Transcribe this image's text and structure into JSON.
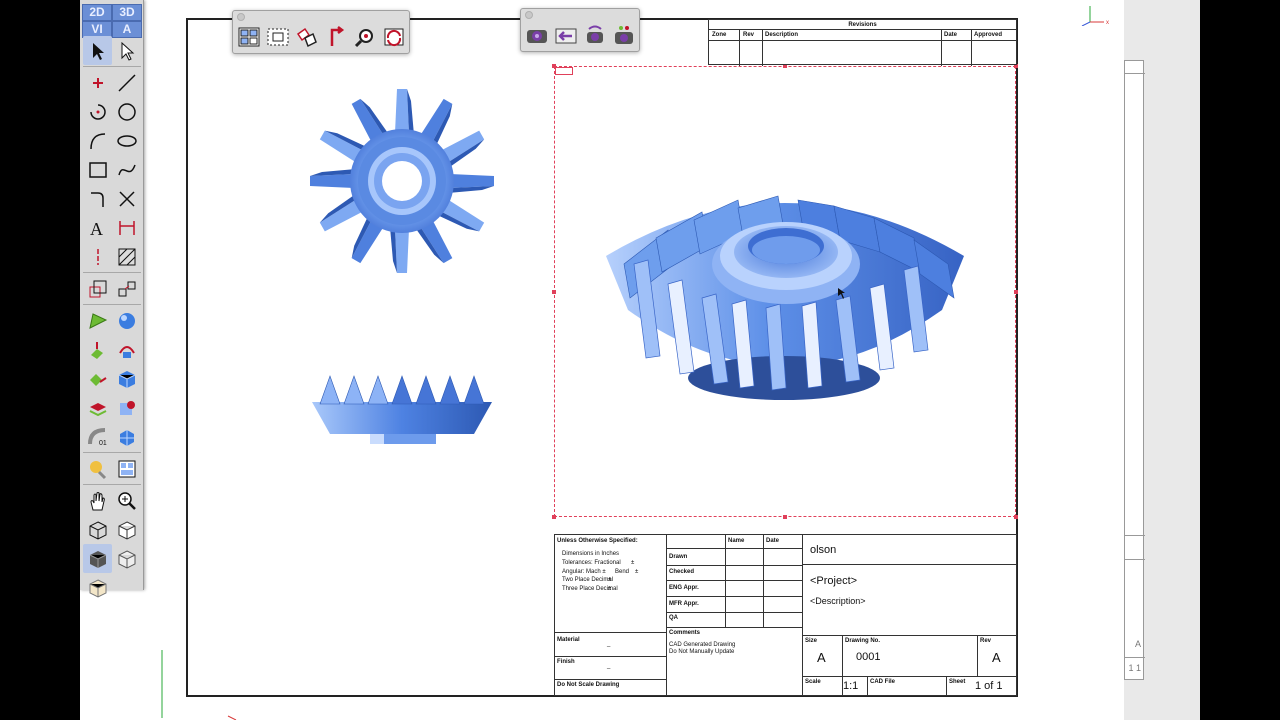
{
  "palette": {
    "mode_labels": [
      "2D",
      "3D",
      "VI",
      "A"
    ],
    "tools": [
      {
        "name": "select-arrow-icon",
        "selected": true
      },
      {
        "name": "select-outline-arrow-icon"
      },
      {
        "name": "point-icon"
      },
      {
        "name": "line-icon"
      },
      {
        "name": "arc-icon"
      },
      {
        "name": "circle-icon"
      },
      {
        "name": "curve-arc-icon"
      },
      {
        "name": "ellipse-icon"
      },
      {
        "name": "rectangle-icon"
      },
      {
        "name": "spline-icon"
      },
      {
        "name": "fillet-icon"
      },
      {
        "name": "trim-icon"
      },
      {
        "name": "text-icon"
      },
      {
        "name": "dimension-icon"
      },
      {
        "name": "centerline-icon"
      },
      {
        "name": "hatch-icon"
      },
      {
        "name": "scale-icon"
      },
      {
        "name": "transform-icon"
      },
      {
        "name": "solid-cone-icon"
      },
      {
        "name": "solid-sphere-icon"
      },
      {
        "name": "extrude-icon"
      },
      {
        "name": "revolve-icon"
      },
      {
        "name": "loft-icon"
      },
      {
        "name": "solid-cube-icon"
      },
      {
        "name": "shell-icon"
      },
      {
        "name": "boolean-icon"
      },
      {
        "name": "blend-icon"
      },
      {
        "name": "mesh-icon"
      },
      {
        "name": "render-light-icon"
      },
      {
        "name": "view-layout-icon"
      },
      {
        "name": "pan-hand-icon"
      },
      {
        "name": "zoom-icon"
      },
      {
        "name": "view-cube-wire-icon"
      },
      {
        "name": "view-cube-outline-icon"
      },
      {
        "name": "view-cube-shaded-icon",
        "selected": true
      },
      {
        "name": "view-cube-hidden-icon"
      },
      {
        "name": "view-cube-alt-icon"
      }
    ]
  },
  "layout_toolbar": {
    "buttons": [
      "layout-grid-icon",
      "marquee-select-icon",
      "align-icon",
      "flip-icon",
      "view-magnify-icon",
      "rotate-view-icon"
    ]
  },
  "camera_toolbar": {
    "buttons": [
      "camera-icon",
      "camera-back-icon",
      "camera-rotate-icon",
      "camera-link-icon"
    ]
  },
  "revisions": {
    "title": "Revisions",
    "headers": [
      "Zone",
      "Rev",
      "Description",
      "Date",
      "Approved"
    ]
  },
  "title_block": {
    "unless_specified": "Unless Otherwise Specified:",
    "dimensions": "Dimensions in Inches",
    "tolerances": "Tolerances: Fractional",
    "tol_fractional_val": "±",
    "angular": "Angular: Mach ±",
    "bend": "Bend",
    "bend_val": "±",
    "two_place": "Two Place Decimal",
    "two_place_val": "±",
    "three_place": "Three Place Decimal",
    "three_place_val": "±",
    "material_label": "Material",
    "material_value": "_",
    "finish_label": "Finish",
    "finish_value": "_",
    "do_not_scale": "Do Not Scale Drawing",
    "col_name": "Name",
    "col_date": "Date",
    "row_drawn": "Drawn",
    "row_checked": "Checked",
    "row_eng": "ENG Appr.",
    "row_mfr": "MFR Appr.",
    "row_qa": "QA",
    "comments_label": "Comments",
    "comment_1": "CAD Generated Drawing",
    "comment_2": "Do Not Manually Update",
    "company": "olson",
    "project": "<Project>",
    "description": "<Description>",
    "size_label": "Size",
    "size_value": "A",
    "drawing_no_label": "Drawing  No.",
    "drawing_no_value": "0001",
    "rev_label": "Rev",
    "rev_value": "A",
    "scale_label": "Scale",
    "scale_value": "1:1",
    "cad_file_label": "CAD File",
    "sheet_label": "Sheet",
    "sheet_value": "1 of 1"
  },
  "background_sheet": {
    "fragments": [
      "A",
      "1  1"
    ]
  },
  "colors": {
    "gear_blue": "#5b8fe6",
    "gear_light": "#a9c8fa",
    "gear_dark": "#2d59b3",
    "view_frame": "#e0405a"
  }
}
